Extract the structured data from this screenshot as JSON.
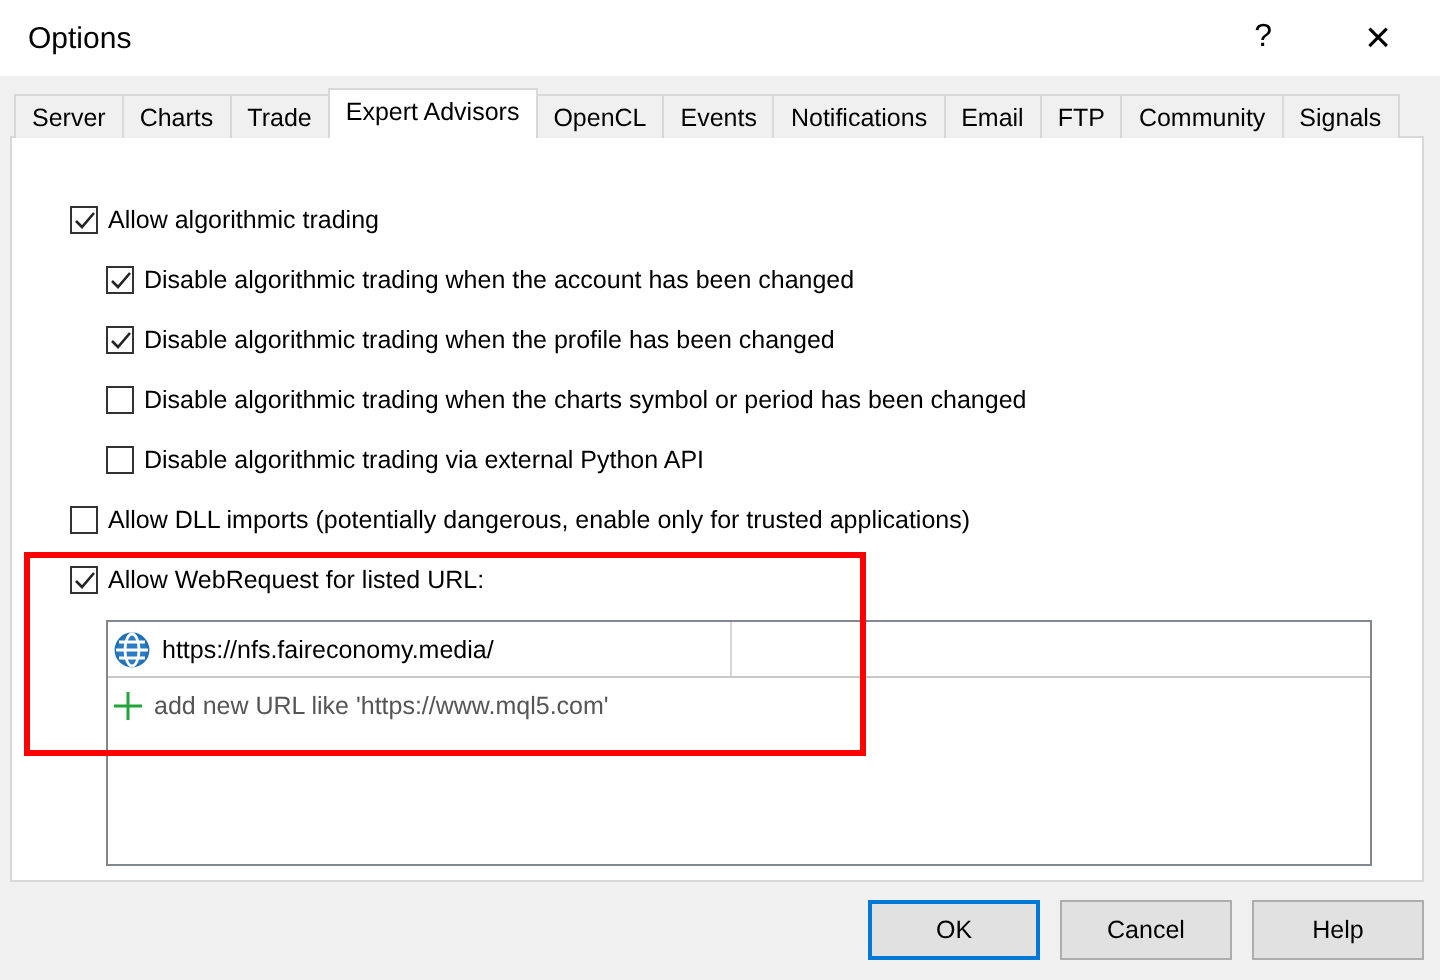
{
  "window": {
    "title": "Options",
    "help": "?",
    "close": "×"
  },
  "tabs": [
    {
      "label": "Server",
      "selected": false
    },
    {
      "label": "Charts",
      "selected": false
    },
    {
      "label": "Trade",
      "selected": false
    },
    {
      "label": "Expert Advisors",
      "selected": true
    },
    {
      "label": "OpenCL",
      "selected": false
    },
    {
      "label": "Events",
      "selected": false
    },
    {
      "label": "Notifications",
      "selected": false
    },
    {
      "label": "Email",
      "selected": false
    },
    {
      "label": "FTP",
      "selected": false
    },
    {
      "label": "Community",
      "selected": false
    },
    {
      "label": "Signals",
      "selected": false
    }
  ],
  "options": [
    {
      "label": "Allow algorithmic trading",
      "checked": true,
      "children": [
        {
          "label": "Disable algorithmic trading when the account has been changed",
          "checked": true
        },
        {
          "label": "Disable algorithmic trading when the profile has been changed",
          "checked": true
        },
        {
          "label": "Disable algorithmic trading when the charts symbol or period has been changed",
          "checked": false
        },
        {
          "label": "Disable algorithmic trading via external Python API",
          "checked": false
        }
      ]
    },
    {
      "label": "Allow DLL imports (potentially dangerous, enable only for trusted applications)",
      "checked": false
    },
    {
      "label": "Allow WebRequest for listed URL:",
      "checked": true
    }
  ],
  "url_list": [
    {
      "kind": "url",
      "text": "https://nfs.faireconomy.media/"
    },
    {
      "kind": "add",
      "text": "add new URL like 'https://www.mql5.com'"
    }
  ],
  "buttons": [
    {
      "label": "OK",
      "default": true
    },
    {
      "label": "Cancel",
      "default": false
    },
    {
      "label": "Help",
      "default": false
    }
  ]
}
